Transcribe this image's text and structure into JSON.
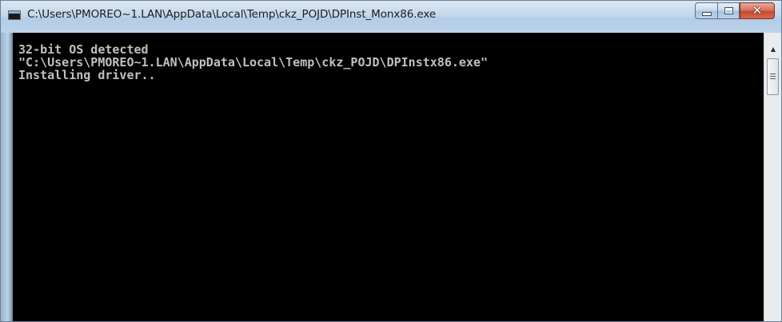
{
  "window": {
    "title": "C:\\Users\\PMOREO~1.LAN\\AppData\\Local\\Temp\\ckz_POJD\\DPInst_Monx86.exe",
    "icon": "console-window-icon",
    "buttons": {
      "minimize": "minimize-icon",
      "maximize": "maximize-icon",
      "close": "close-icon"
    }
  },
  "console": {
    "lines": [
      "32-bit OS detected",
      "\"C:\\Users\\PMOREO~1.LAN\\AppData\\Local\\Temp\\ckz_POJD\\DPInstx86.exe\"",
      "Installing driver.."
    ]
  },
  "colors": {
    "console_background": "#000000",
    "console_text": "#c0c0c0",
    "close_button": "#c9553b"
  }
}
